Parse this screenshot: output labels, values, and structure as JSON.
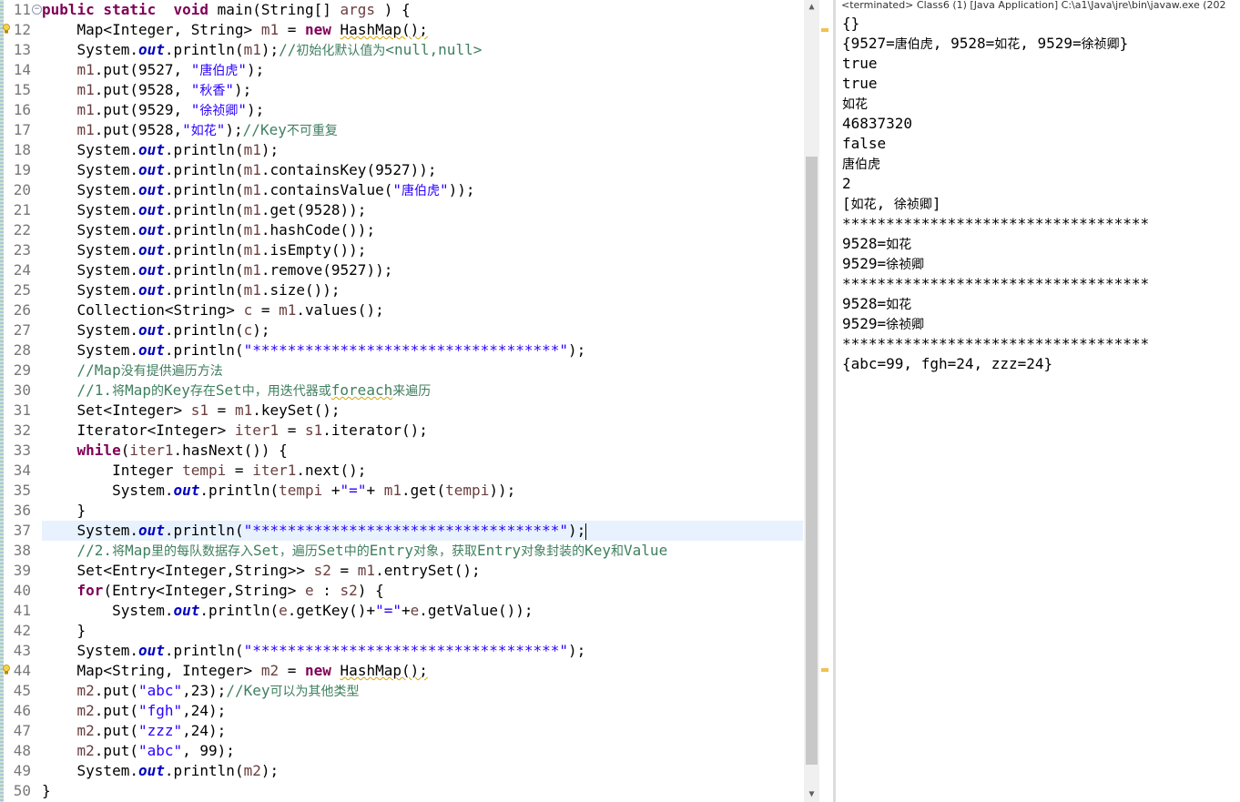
{
  "console": {
    "header": "<terminated> Class6 (1) [Java Application] C:\\a1\\Java\\jre\\bin\\javaw.exe (202",
    "output": [
      "{}",
      "{9527=唐伯虎, 9528=如花, 9529=徐祯卿}",
      "true",
      "true",
      "如花",
      "46837320",
      "false",
      "唐伯虎",
      "2",
      "[如花, 徐祯卿]",
      "***********************************",
      "9528=如花",
      "9529=徐祯卿",
      "***********************************",
      "9528=如花",
      "9529=徐祯卿",
      "***********************************",
      "{abc=99, fgh=24, zzz=24}"
    ]
  },
  "editor": {
    "line_numbers": [
      "11",
      "12",
      "13",
      "14",
      "15",
      "16",
      "17",
      "18",
      "19",
      "20",
      "21",
      "22",
      "23",
      "24",
      "25",
      "26",
      "27",
      "28",
      "29",
      "30",
      "31",
      "32",
      "33",
      "34",
      "35",
      "36",
      "37",
      "38",
      "39",
      "40",
      "41",
      "42",
      "43",
      "44",
      "45",
      "46",
      "47",
      "48",
      "49",
      "50"
    ],
    "lines": [
      [
        [
          "kw",
          "public static"
        ],
        [
          "",
          "  "
        ],
        [
          "kw",
          "void"
        ],
        [
          "",
          " main(String[] "
        ],
        [
          "var",
          "args"
        ],
        [
          "",
          " ) {"
        ]
      ],
      [
        [
          "",
          "    Map<Integer, String> "
        ],
        [
          "var",
          "m1"
        ],
        [
          "",
          " = "
        ],
        [
          "kw",
          "new"
        ],
        [
          "",
          " HashMap();"
        ]
      ],
      [
        [
          "",
          "    System."
        ],
        [
          "fld",
          "out"
        ],
        [
          "",
          ".println("
        ],
        [
          "var",
          "m1"
        ],
        [
          "",
          ");"
        ],
        [
          "cmt",
          "//初始化默认值为<null,null>"
        ]
      ],
      [
        [
          "",
          "    "
        ],
        [
          "var",
          "m1"
        ],
        [
          "",
          ".put(9527, "
        ],
        [
          "str",
          "\"唐伯虎\""
        ],
        [
          "",
          ");"
        ]
      ],
      [
        [
          "",
          "    "
        ],
        [
          "var",
          "m1"
        ],
        [
          "",
          ".put(9528, "
        ],
        [
          "str",
          "\"秋香\""
        ],
        [
          "",
          ");"
        ]
      ],
      [
        [
          "",
          "    "
        ],
        [
          "var",
          "m1"
        ],
        [
          "",
          ".put(9529, "
        ],
        [
          "str",
          "\"徐祯卿\""
        ],
        [
          "",
          ");"
        ]
      ],
      [
        [
          "",
          "    "
        ],
        [
          "var",
          "m1"
        ],
        [
          "",
          ".put(9528,"
        ],
        [
          "str",
          "\"如花\""
        ],
        [
          "",
          ");"
        ],
        [
          "cmt",
          "//Key不可重复"
        ]
      ],
      [
        [
          "",
          "    System."
        ],
        [
          "fld",
          "out"
        ],
        [
          "",
          ".println("
        ],
        [
          "var",
          "m1"
        ],
        [
          "",
          ");"
        ]
      ],
      [
        [
          "",
          "    System."
        ],
        [
          "fld",
          "out"
        ],
        [
          "",
          ".println("
        ],
        [
          "var",
          "m1"
        ],
        [
          "",
          ".containsKey(9527));"
        ]
      ],
      [
        [
          "",
          "    System."
        ],
        [
          "fld",
          "out"
        ],
        [
          "",
          ".println("
        ],
        [
          "var",
          "m1"
        ],
        [
          "",
          ".containsValue("
        ],
        [
          "str",
          "\"唐伯虎\""
        ],
        [
          "",
          "));"
        ]
      ],
      [
        [
          "",
          "    System."
        ],
        [
          "fld",
          "out"
        ],
        [
          "",
          ".println("
        ],
        [
          "var",
          "m1"
        ],
        [
          "",
          ".get(9528));"
        ]
      ],
      [
        [
          "",
          "    System."
        ],
        [
          "fld",
          "out"
        ],
        [
          "",
          ".println("
        ],
        [
          "var",
          "m1"
        ],
        [
          "",
          ".hashCode());"
        ]
      ],
      [
        [
          "",
          "    System."
        ],
        [
          "fld",
          "out"
        ],
        [
          "",
          ".println("
        ],
        [
          "var",
          "m1"
        ],
        [
          "",
          ".isEmpty());"
        ]
      ],
      [
        [
          "",
          "    System."
        ],
        [
          "fld",
          "out"
        ],
        [
          "",
          ".println("
        ],
        [
          "var",
          "m1"
        ],
        [
          "",
          ".remove(9527));"
        ]
      ],
      [
        [
          "",
          "    System."
        ],
        [
          "fld",
          "out"
        ],
        [
          "",
          ".println("
        ],
        [
          "var",
          "m1"
        ],
        [
          "",
          ".size());"
        ]
      ],
      [
        [
          "",
          "    Collection<String> "
        ],
        [
          "var",
          "c"
        ],
        [
          "",
          " = "
        ],
        [
          "var",
          "m1"
        ],
        [
          "",
          ".values();"
        ]
      ],
      [
        [
          "",
          "    System."
        ],
        [
          "fld",
          "out"
        ],
        [
          "",
          ".println("
        ],
        [
          "var",
          "c"
        ],
        [
          "",
          ");"
        ]
      ],
      [
        [
          "",
          "    System."
        ],
        [
          "fld",
          "out"
        ],
        [
          "",
          ".println("
        ],
        [
          "str",
          "\"***********************************\""
        ],
        [
          "",
          ");"
        ]
      ],
      [
        [
          "",
          "    "
        ],
        [
          "cmt",
          "//Map没有提供遍历方法"
        ]
      ],
      [
        [
          "",
          "    "
        ],
        [
          "cmt",
          "//1.将Map的Key存在Set中，用迭代器或foreach来遍历"
        ]
      ],
      [
        [
          "",
          "    Set<Integer> "
        ],
        [
          "var",
          "s1"
        ],
        [
          "",
          " = "
        ],
        [
          "var",
          "m1"
        ],
        [
          "",
          ".keySet();"
        ]
      ],
      [
        [
          "",
          "    Iterator<Integer> "
        ],
        [
          "var",
          "iter1"
        ],
        [
          "",
          " = "
        ],
        [
          "var",
          "s1"
        ],
        [
          "",
          ".iterator();"
        ]
      ],
      [
        [
          "",
          "    "
        ],
        [
          "kw",
          "while"
        ],
        [
          "",
          "("
        ],
        [
          "var",
          "iter1"
        ],
        [
          "",
          ".hasNext()) {"
        ]
      ],
      [
        [
          "",
          "        Integer "
        ],
        [
          "var",
          "tempi"
        ],
        [
          "",
          " = "
        ],
        [
          "var",
          "iter1"
        ],
        [
          "",
          ".next();"
        ]
      ],
      [
        [
          "",
          "        System."
        ],
        [
          "fld",
          "out"
        ],
        [
          "",
          ".println("
        ],
        [
          "var",
          "tempi"
        ],
        [
          "",
          " +"
        ],
        [
          "str",
          "\"=\""
        ],
        [
          "",
          "+ "
        ],
        [
          "var",
          "m1"
        ],
        [
          "",
          ".get("
        ],
        [
          "var",
          "tempi"
        ],
        [
          "",
          "));"
        ]
      ],
      [
        [
          "",
          "    }"
        ]
      ],
      [
        [
          "",
          "    System."
        ],
        [
          "fld",
          "out"
        ],
        [
          "",
          ".println("
        ],
        [
          "str",
          "\"***********************************\""
        ],
        [
          "",
          ");"
        ]
      ],
      [
        [
          "",
          "    "
        ],
        [
          "cmt",
          "//2.将Map里的每队数据存入Set，遍历Set中的Entry对象，获取Entry对象封装的Key和Value"
        ]
      ],
      [
        [
          "",
          "    Set<Entry<Integer,String>> "
        ],
        [
          "var",
          "s2"
        ],
        [
          "",
          " = "
        ],
        [
          "var",
          "m1"
        ],
        [
          "",
          ".entrySet();"
        ]
      ],
      [
        [
          "",
          "    "
        ],
        [
          "kw",
          "for"
        ],
        [
          "",
          "(Entry<Integer,String> "
        ],
        [
          "var",
          "e"
        ],
        [
          "",
          " : "
        ],
        [
          "var",
          "s2"
        ],
        [
          "",
          ") {"
        ]
      ],
      [
        [
          "",
          "        System."
        ],
        [
          "fld",
          "out"
        ],
        [
          "",
          ".println("
        ],
        [
          "var",
          "e"
        ],
        [
          "",
          ".getKey()+"
        ],
        [
          "str",
          "\"=\""
        ],
        [
          "",
          "+"
        ],
        [
          "var",
          "e"
        ],
        [
          "",
          ".getValue());"
        ]
      ],
      [
        [
          "",
          "    }"
        ]
      ],
      [
        [
          "",
          "    System."
        ],
        [
          "fld",
          "out"
        ],
        [
          "",
          ".println("
        ],
        [
          "str",
          "\"***********************************\""
        ],
        [
          "",
          ");"
        ]
      ],
      [
        [
          "",
          "    Map<String, Integer> "
        ],
        [
          "var",
          "m2"
        ],
        [
          "",
          " = "
        ],
        [
          "kw",
          "new"
        ],
        [
          "",
          " HashMap();"
        ]
      ],
      [
        [
          "",
          "    "
        ],
        [
          "var",
          "m2"
        ],
        [
          "",
          ".put("
        ],
        [
          "str",
          "\"abc\""
        ],
        [
          "",
          ",23);"
        ],
        [
          "cmt",
          "//Key可以为其他类型"
        ]
      ],
      [
        [
          "",
          "    "
        ],
        [
          "var",
          "m2"
        ],
        [
          "",
          ".put("
        ],
        [
          "str",
          "\"fgh\""
        ],
        [
          "",
          ",24);"
        ]
      ],
      [
        [
          "",
          "    "
        ],
        [
          "var",
          "m2"
        ],
        [
          "",
          ".put("
        ],
        [
          "str",
          "\"zzz\""
        ],
        [
          "",
          ",24);"
        ]
      ],
      [
        [
          "",
          "    "
        ],
        [
          "var",
          "m2"
        ],
        [
          "",
          ".put("
        ],
        [
          "str",
          "\"abc\""
        ],
        [
          "",
          ", 99);"
        ]
      ],
      [
        [
          "",
          "    System."
        ],
        [
          "fld",
          "out"
        ],
        [
          "",
          ".println("
        ],
        [
          "var",
          "m2"
        ],
        [
          "",
          ");"
        ]
      ],
      [
        [
          "",
          "}"
        ]
      ]
    ],
    "current_line_index": 26,
    "warning_line_indices": [
      1,
      33
    ],
    "folded_line_index": 0,
    "squiggle_targets": [
      "HashMap();",
      "foreach"
    ]
  },
  "colors": {
    "keyword": "#7f0055",
    "field": "#0000c0",
    "string": "#2a00ff",
    "comment": "#3f7f5f",
    "variable": "#6a3e3e",
    "current_line": "#e8f2fe"
  }
}
